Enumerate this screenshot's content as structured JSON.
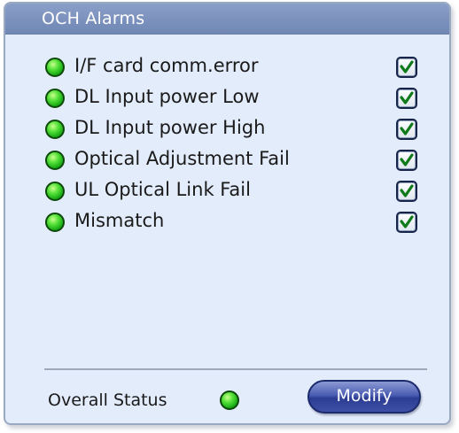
{
  "panel": {
    "title": "OCH Alarms"
  },
  "alarms": [
    {
      "label": "I/F card comm.error",
      "status": "ok",
      "enabled": true
    },
    {
      "label": "DL Input power Low",
      "status": "ok",
      "enabled": true
    },
    {
      "label": "DL Input power High",
      "status": "ok",
      "enabled": true
    },
    {
      "label": "Optical Adjustment Fail",
      "status": "ok",
      "enabled": true
    },
    {
      "label": "UL Optical Link Fail",
      "status": "ok",
      "enabled": true
    },
    {
      "label": "Mismatch",
      "status": "ok",
      "enabled": true
    }
  ],
  "footer": {
    "overall_status_label": "Overall Status",
    "overall_status": "ok",
    "modify_label": "Modify"
  },
  "colors": {
    "led_ok": "#2bc41f",
    "check_mark": "#0f7a1a",
    "header": "#7d92be",
    "panel_bg": "#e3ecfb",
    "button": "#3b4ea6"
  },
  "icons": {
    "led": "status-led-icon",
    "check": "checkmark-icon"
  }
}
